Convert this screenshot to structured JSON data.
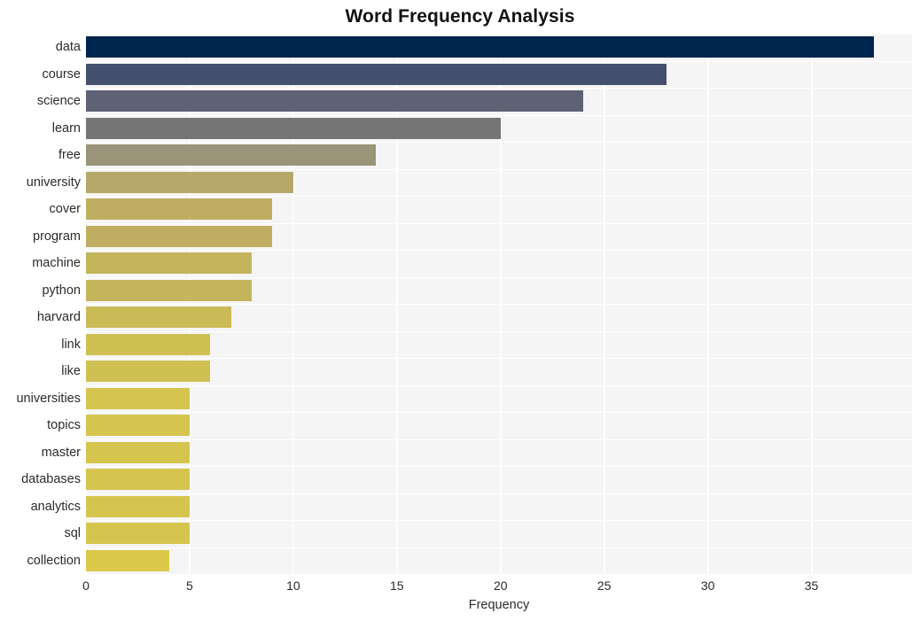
{
  "chart_data": {
    "type": "bar",
    "orientation": "horizontal",
    "title": "Word Frequency Analysis",
    "xlabel": "Frequency",
    "ylabel": "",
    "categories": [
      "data",
      "course",
      "science",
      "learn",
      "free",
      "university",
      "cover",
      "program",
      "machine",
      "python",
      "harvard",
      "link",
      "like",
      "universities",
      "topics",
      "master",
      "databases",
      "analytics",
      "sql",
      "collection"
    ],
    "values": [
      38,
      28,
      24,
      20,
      14,
      10,
      9,
      9,
      8,
      8,
      7,
      6,
      6,
      5,
      5,
      5,
      5,
      5,
      5,
      4
    ],
    "xticks": [
      "0",
      "5",
      "10",
      "15",
      "20",
      "25",
      "30",
      "35"
    ],
    "xtick_values": [
      0,
      5,
      10,
      15,
      20,
      25,
      30,
      35
    ],
    "xlim": [
      0,
      39.85
    ],
    "grid": true,
    "legend": false,
    "bar_colors": [
      "#00264f",
      "#454f6e",
      "#5e6274",
      "#757575",
      "#9a9478",
      "#b6a868",
      "#bfae62",
      "#bfae62",
      "#c4b45c",
      "#c4b45c",
      "#cabb57",
      "#cfc053",
      "#cfc053",
      "#d5c54e",
      "#d5c54e",
      "#d5c54e",
      "#d5c54e",
      "#d5c54e",
      "#d5c54e",
      "#dcc949"
    ],
    "plot_background": "#f5f5f6",
    "grid_color": "#ffffff",
    "figure_background": "#ffffff",
    "text_color": "#2b2b2b",
    "title_color": "#131313"
  }
}
